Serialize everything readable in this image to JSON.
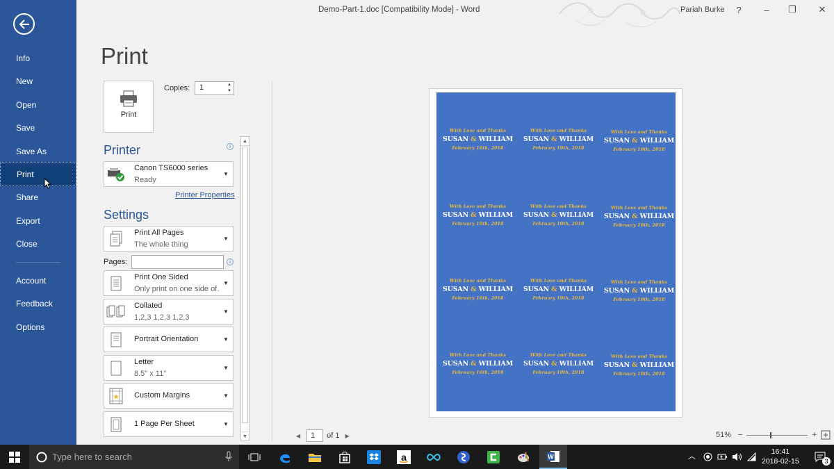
{
  "window": {
    "title": "Demo-Part-1.doc [Compatibility Mode]  -  Word",
    "user": "Pariah Burke",
    "help": "?",
    "minimize": "–",
    "restore": "❐",
    "close": "✕"
  },
  "nav": {
    "items": [
      "Info",
      "New",
      "Open",
      "Save",
      "Save As",
      "Print",
      "Share",
      "Export",
      "Close"
    ],
    "bottom_items": [
      "Account",
      "Feedback",
      "Options"
    ],
    "active": "Print"
  },
  "print": {
    "heading": "Print",
    "button_label": "Print",
    "copies_label": "Copies:",
    "copies_value": "1",
    "printer_heading": "Printer",
    "printer_name": "Canon TS6000 series",
    "printer_status": "Ready",
    "printer_properties": "Printer Properties",
    "settings_heading": "Settings",
    "pages_label": "Pages:",
    "pages_value": "",
    "settings": [
      {
        "line1": "Print All Pages",
        "line2": "The whole thing"
      },
      {
        "line1": "Print One Sided",
        "line2": "Only print on one side of..."
      },
      {
        "line1": "Collated",
        "line2": "1,2,3    1,2,3    1,2,3"
      },
      {
        "line1": "Portrait Orientation",
        "line2": ""
      },
      {
        "line1": "Letter",
        "line2": "8.5\" x 11\""
      },
      {
        "line1": "Custom Margins",
        "line2": ""
      },
      {
        "line1": "1 Page Per Sheet",
        "line2": ""
      }
    ]
  },
  "preview": {
    "card": {
      "line1": "With Love and Thanks",
      "name_a": "SUSAN",
      "amp": "&",
      "name_b": "WILLIAM",
      "date": "February 10th, 2018"
    },
    "current_page": "1",
    "of_pages": "of 1",
    "zoom": "51%",
    "colors": {
      "card_bg": "#4472c4",
      "accent": "#e8b93e"
    }
  },
  "taskbar": {
    "search_placeholder": "Type here to search",
    "time": "16:41",
    "date": "2018-02-15",
    "notification_count": "3"
  },
  "colors": {
    "nav_bg": "#2b579a",
    "taskbar_bg": "#1a1a1a"
  }
}
